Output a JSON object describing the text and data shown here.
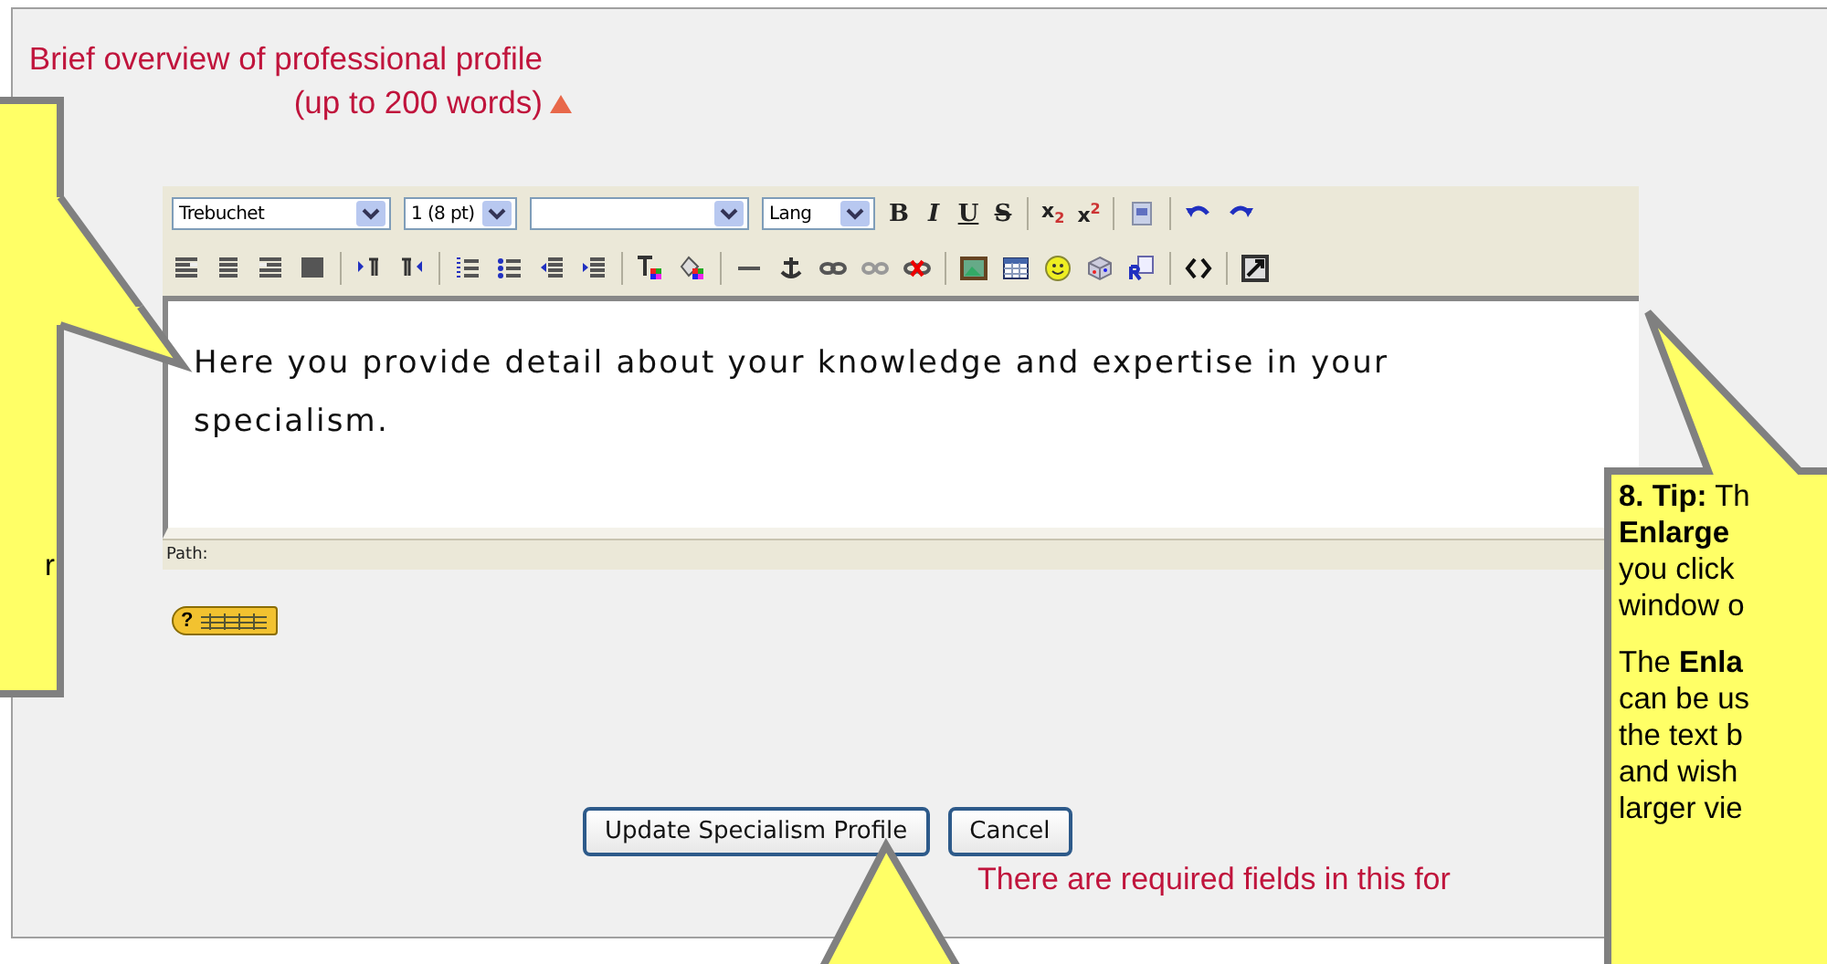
{
  "field": {
    "label": "Brief overview of professional profile (up to 200 words)",
    "required": true
  },
  "editor": {
    "selects": [
      {
        "kind": "wide",
        "value": "Trebuchet"
      },
      {
        "kind": "narrow",
        "value": "1 (8 pt)"
      },
      {
        "kind": "wide"
      },
      {
        "kind": "narrow",
        "value": "Lang"
      }
    ],
    "format_buttons": [
      "B",
      "I",
      "U",
      "S"
    ],
    "script_buttons": [
      "x$_{2}$",
      "x$^{2}$"
    ],
    "content": "Here you provide detail about your knowledge and expertise in your specialism.",
    "path_label": "Path:",
    "help_label": "?"
  },
  "buttons": [
    "Update Specialism Profile",
    "Cancel"
  ],
  "required_note": "There are required fields in this for",
  "callouts": [
    {
      "kind": "left",
      "paragraphs": [
        [
          "r"
        ]
      ]
    },
    {
      "kind": "right",
      "paragraphs": [
        [
          "**8. Tip:** Th",
          "**Enlarge**",
          "you click",
          "window o"
        ],
        [
          "The **Enla**",
          "can be us",
          "the text b",
          "and wish",
          "larger vie"
        ]
      ]
    },
    {
      "kind": "bottom"
    }
  ]
}
